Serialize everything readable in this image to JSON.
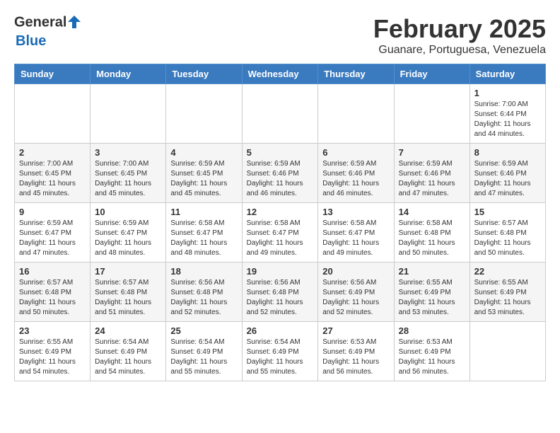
{
  "header": {
    "logo_general": "General",
    "logo_blue": "Blue",
    "month_title": "February 2025",
    "location": "Guanare, Portuguesa, Venezuela"
  },
  "weekdays": [
    "Sunday",
    "Monday",
    "Tuesday",
    "Wednesday",
    "Thursday",
    "Friday",
    "Saturday"
  ],
  "weeks": [
    [
      {
        "day": "",
        "info": ""
      },
      {
        "day": "",
        "info": ""
      },
      {
        "day": "",
        "info": ""
      },
      {
        "day": "",
        "info": ""
      },
      {
        "day": "",
        "info": ""
      },
      {
        "day": "",
        "info": ""
      },
      {
        "day": "1",
        "info": "Sunrise: 7:00 AM\nSunset: 6:44 PM\nDaylight: 11 hours and 44 minutes."
      }
    ],
    [
      {
        "day": "2",
        "info": "Sunrise: 7:00 AM\nSunset: 6:45 PM\nDaylight: 11 hours and 45 minutes."
      },
      {
        "day": "3",
        "info": "Sunrise: 7:00 AM\nSunset: 6:45 PM\nDaylight: 11 hours and 45 minutes."
      },
      {
        "day": "4",
        "info": "Sunrise: 6:59 AM\nSunset: 6:45 PM\nDaylight: 11 hours and 45 minutes."
      },
      {
        "day": "5",
        "info": "Sunrise: 6:59 AM\nSunset: 6:46 PM\nDaylight: 11 hours and 46 minutes."
      },
      {
        "day": "6",
        "info": "Sunrise: 6:59 AM\nSunset: 6:46 PM\nDaylight: 11 hours and 46 minutes."
      },
      {
        "day": "7",
        "info": "Sunrise: 6:59 AM\nSunset: 6:46 PM\nDaylight: 11 hours and 47 minutes."
      },
      {
        "day": "8",
        "info": "Sunrise: 6:59 AM\nSunset: 6:46 PM\nDaylight: 11 hours and 47 minutes."
      }
    ],
    [
      {
        "day": "9",
        "info": "Sunrise: 6:59 AM\nSunset: 6:47 PM\nDaylight: 11 hours and 47 minutes."
      },
      {
        "day": "10",
        "info": "Sunrise: 6:59 AM\nSunset: 6:47 PM\nDaylight: 11 hours and 48 minutes."
      },
      {
        "day": "11",
        "info": "Sunrise: 6:58 AM\nSunset: 6:47 PM\nDaylight: 11 hours and 48 minutes."
      },
      {
        "day": "12",
        "info": "Sunrise: 6:58 AM\nSunset: 6:47 PM\nDaylight: 11 hours and 49 minutes."
      },
      {
        "day": "13",
        "info": "Sunrise: 6:58 AM\nSunset: 6:47 PM\nDaylight: 11 hours and 49 minutes."
      },
      {
        "day": "14",
        "info": "Sunrise: 6:58 AM\nSunset: 6:48 PM\nDaylight: 11 hours and 50 minutes."
      },
      {
        "day": "15",
        "info": "Sunrise: 6:57 AM\nSunset: 6:48 PM\nDaylight: 11 hours and 50 minutes."
      }
    ],
    [
      {
        "day": "16",
        "info": "Sunrise: 6:57 AM\nSunset: 6:48 PM\nDaylight: 11 hours and 50 minutes."
      },
      {
        "day": "17",
        "info": "Sunrise: 6:57 AM\nSunset: 6:48 PM\nDaylight: 11 hours and 51 minutes."
      },
      {
        "day": "18",
        "info": "Sunrise: 6:56 AM\nSunset: 6:48 PM\nDaylight: 11 hours and 52 minutes."
      },
      {
        "day": "19",
        "info": "Sunrise: 6:56 AM\nSunset: 6:48 PM\nDaylight: 11 hours and 52 minutes."
      },
      {
        "day": "20",
        "info": "Sunrise: 6:56 AM\nSunset: 6:49 PM\nDaylight: 11 hours and 52 minutes."
      },
      {
        "day": "21",
        "info": "Sunrise: 6:55 AM\nSunset: 6:49 PM\nDaylight: 11 hours and 53 minutes."
      },
      {
        "day": "22",
        "info": "Sunrise: 6:55 AM\nSunset: 6:49 PM\nDaylight: 11 hours and 53 minutes."
      }
    ],
    [
      {
        "day": "23",
        "info": "Sunrise: 6:55 AM\nSunset: 6:49 PM\nDaylight: 11 hours and 54 minutes."
      },
      {
        "day": "24",
        "info": "Sunrise: 6:54 AM\nSunset: 6:49 PM\nDaylight: 11 hours and 54 minutes."
      },
      {
        "day": "25",
        "info": "Sunrise: 6:54 AM\nSunset: 6:49 PM\nDaylight: 11 hours and 55 minutes."
      },
      {
        "day": "26",
        "info": "Sunrise: 6:54 AM\nSunset: 6:49 PM\nDaylight: 11 hours and 55 minutes."
      },
      {
        "day": "27",
        "info": "Sunrise: 6:53 AM\nSunset: 6:49 PM\nDaylight: 11 hours and 56 minutes."
      },
      {
        "day": "28",
        "info": "Sunrise: 6:53 AM\nSunset: 6:49 PM\nDaylight: 11 hours and 56 minutes."
      },
      {
        "day": "",
        "info": ""
      }
    ]
  ]
}
